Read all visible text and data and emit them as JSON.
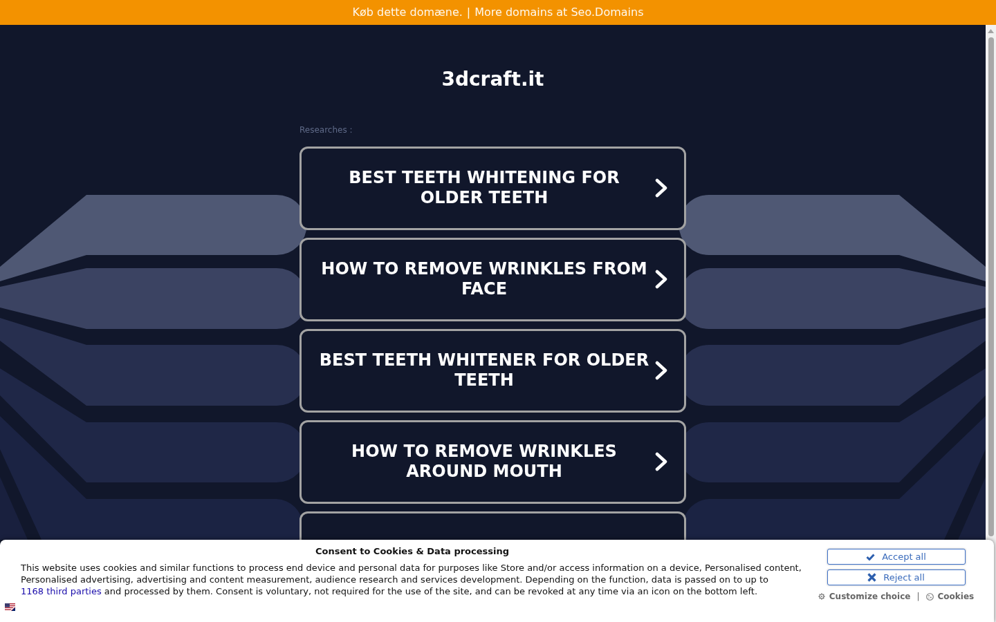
{
  "top_bar": {
    "links": [
      {
        "label": "Køb dette domæne."
      },
      {
        "label": "More domains at Seo.Domains"
      }
    ],
    "separator": "|"
  },
  "site_title": "3dcraft.it",
  "search_results": {
    "label": "Researches :",
    "links": [
      "BEST TEETH WHITENING FOR OLDER TEETH",
      "HOW TO REMOVE WRINKLES FROM FACE",
      "BEST TEETH WHITENER FOR OLDER TEETH",
      "HOW TO REMOVE WRINKLES AROUND MOUTH"
    ]
  },
  "cookie_banner": {
    "title": "Consent to Cookies & Data processing",
    "text_before": "This website uses cookies and similar functions to process end device and personal data for purposes like Store and/or access information on a device, Personalised content, Personalised advertising, advertising and content measurement, audience research and services development. Depending on the function, data is passed on to up to",
    "link": "1168 third parties",
    "text_after": "and processed by them. Consent is voluntary, not required for the use of the site, and can be revoked at any time via an icon on the bottom left.",
    "buttons": [
      {
        "kind": "accept",
        "label": "Accept all"
      },
      {
        "kind": "reject",
        "label": "Reject all"
      }
    ],
    "links": [
      {
        "kind": "customize",
        "label": "Customize choice"
      },
      {
        "kind": "cookies",
        "label": "Cookies"
      }
    ],
    "separator": "|"
  }
}
